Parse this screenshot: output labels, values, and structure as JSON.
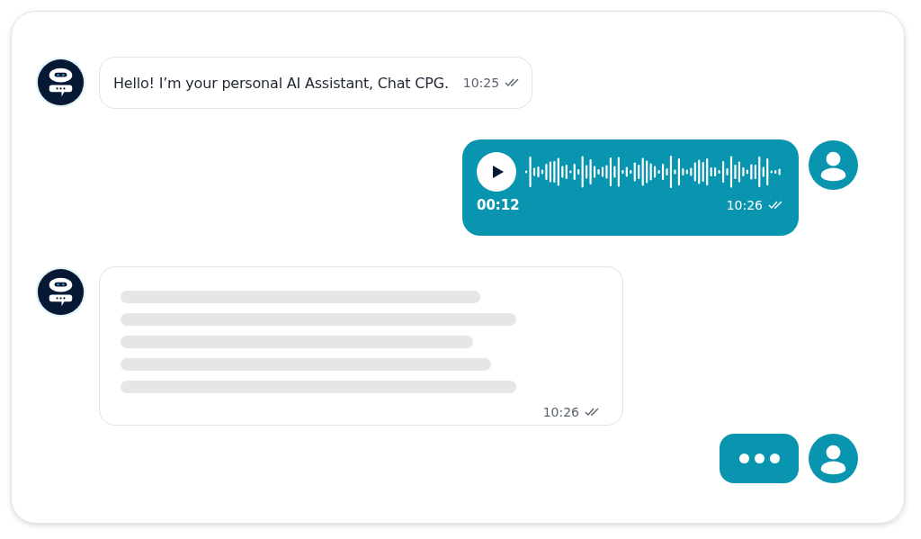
{
  "messages": [
    {
      "outgoing": false,
      "kind": "text",
      "text": "Hello! I’m your personal AI Assistant, Chat CPG.",
      "time": "10:25",
      "read": true
    },
    {
      "outgoing": true,
      "kind": "voice",
      "duration": "00:12",
      "time": "10:26",
      "read": true
    },
    {
      "outgoing": false,
      "kind": "loading",
      "time": "10:26",
      "read": true
    },
    {
      "outgoing": true,
      "kind": "typing"
    }
  ]
}
